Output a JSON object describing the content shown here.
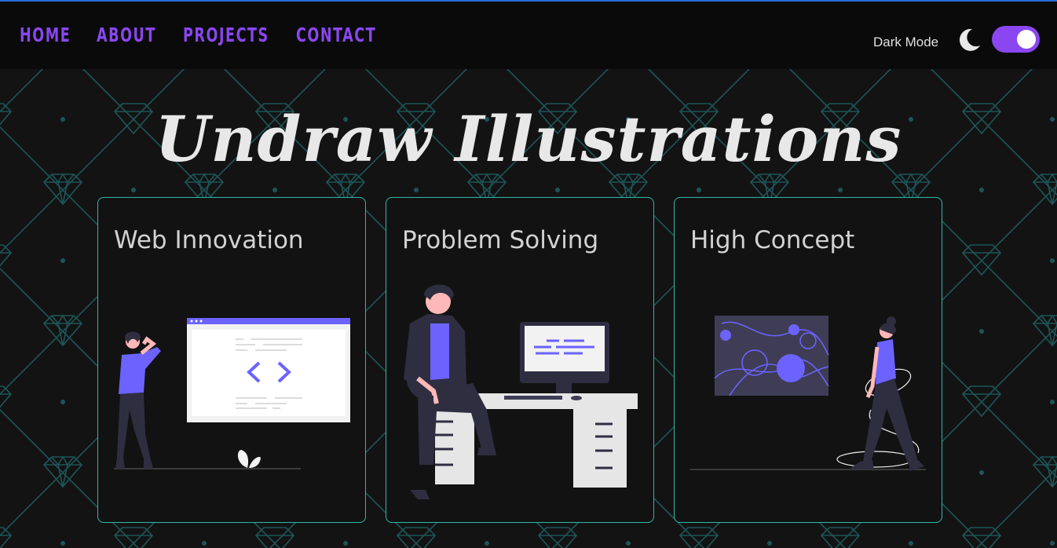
{
  "nav": {
    "links": [
      "HOME",
      "ABOUT",
      "PROJECTS",
      "CONTACT"
    ],
    "dark_mode_label": "Dark Mode",
    "dark_mode_on": true
  },
  "hero": {
    "title": "Undraw Illustrations"
  },
  "cards": [
    {
      "title": "Web Innovation"
    },
    {
      "title": "Problem Solving"
    },
    {
      "title": "High Concept"
    }
  ],
  "colors": {
    "accent": "#8a46f0",
    "illustration_purple": "#6c63ff",
    "card_border": "#2fb9a6",
    "pattern": "#1e5a5c",
    "background": "#131313"
  }
}
